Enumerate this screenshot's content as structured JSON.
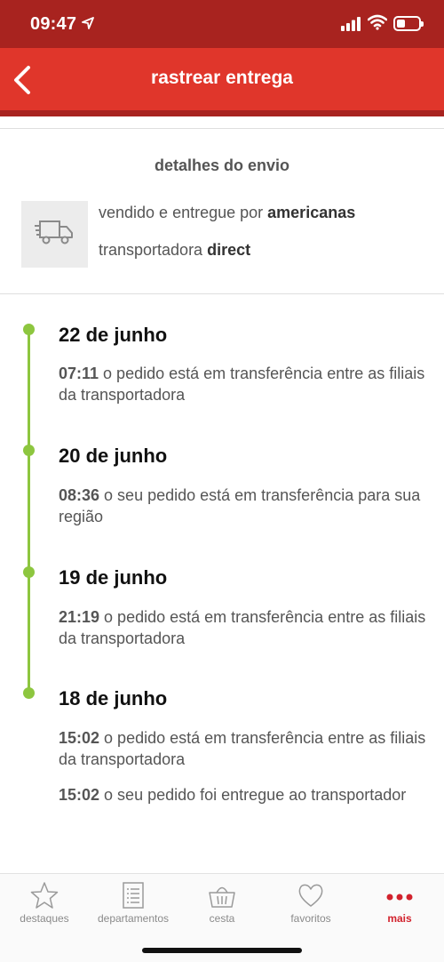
{
  "status_bar": {
    "time": "09:47"
  },
  "header": {
    "title": "rastrear entrega"
  },
  "shipping": {
    "title": "detalhes do envio",
    "sold_prefix": "vendido e entregue por ",
    "seller": "americanas",
    "carrier_prefix": "transportadora ",
    "carrier": "direct"
  },
  "timeline": [
    {
      "date": "22 de junho",
      "events": [
        {
          "time": "07:11",
          "text": " o pedido está em transferência entre as filiais da transportadora"
        }
      ]
    },
    {
      "date": "20 de junho",
      "events": [
        {
          "time": "08:36",
          "text": " o seu pedido está em transferência para sua região"
        }
      ]
    },
    {
      "date": "19 de junho",
      "events": [
        {
          "time": "21:19",
          "text": " o pedido está em transferência entre as filiais da transportadora"
        }
      ]
    },
    {
      "date": "18 de junho",
      "events": [
        {
          "time": "15:02",
          "text": " o pedido está em transferência entre as filiais da transportadora"
        },
        {
          "time": "15:02",
          "text": " o seu pedido foi entregue ao transportador"
        }
      ]
    }
  ],
  "tabs": [
    {
      "label": "destaques",
      "icon": "star-icon"
    },
    {
      "label": "departamentos",
      "icon": "list-icon"
    },
    {
      "label": "cesta",
      "icon": "basket-icon"
    },
    {
      "label": "favoritos",
      "icon": "heart-icon"
    },
    {
      "label": "mais",
      "icon": "more-dots-icon",
      "active": true
    }
  ],
  "colors": {
    "brand_red": "#e0362b",
    "dark_red": "#a8231f",
    "timeline_green": "#8dc63f",
    "active_tab": "#d2222d"
  }
}
